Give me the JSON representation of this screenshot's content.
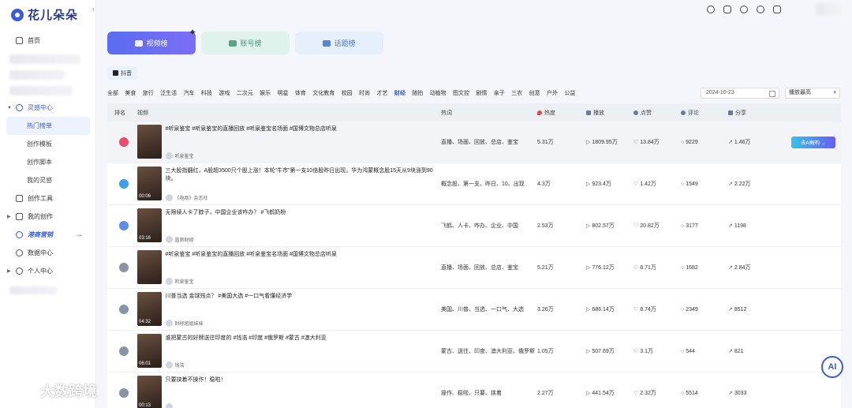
{
  "app": {
    "name": "花儿朵朵"
  },
  "sidebar": {
    "home": "首页",
    "inspiration": "灵感中心",
    "sub_items": [
      "热门榜单",
      "创作模板",
      "创作脚本",
      "我的灵感"
    ],
    "tools": "创作工具",
    "my_creation": "我的创作",
    "promo": "港商营销",
    "data_center": "数据中心",
    "personal_center": "个人中心"
  },
  "tabs": [
    {
      "label": "视频榜",
      "active": true
    },
    {
      "label": "账号榜",
      "active": false
    },
    {
      "label": "话题榜",
      "active": false
    }
  ],
  "platform": {
    "label": "抖音"
  },
  "categories": [
    "全部",
    "美食",
    "旅行",
    "泛生活",
    "汽车",
    "科技",
    "游戏",
    "二次元",
    "娱乐",
    "明星",
    "体育",
    "文化教育",
    "校园",
    "时尚",
    "才艺",
    "财经",
    "随拍",
    "动植物",
    "图文控",
    "剧情",
    "亲子",
    "三农",
    "创意",
    "户外",
    "公益"
  ],
  "active_category": "财经",
  "filters": {
    "date": "2024-10-23",
    "sort": "播放最高"
  },
  "table": {
    "headers": {
      "rank": "排名",
      "video": "视频",
      "hot": "热词",
      "heat": "热度",
      "play": "播放",
      "like": "点赞",
      "comment": "评论",
      "share": "分享"
    },
    "action_label": "去AI解构 →",
    "rows": [
      {
        "title": "#听泉鉴宝 #听泉鉴宝的直播回放 #听泉鉴宝名场面 #国博文物总店听泉",
        "author": "听泉鉴宝",
        "duration": "",
        "hot": "直播、场面、回放、总店、鉴宝",
        "heat": "5.31万",
        "play": "1809.95万",
        "like": "13.84万",
        "comment": "9229",
        "share": "1.46万",
        "medal": "#e94b6c"
      },
      {
        "title": "三大股指翻红，A股超3500只个股上涨！本轮“牛市”第一支10倍股昨日出现，华为鸿蒙概念股15天从9块涨到90块。",
        "author": "《电商》杂志社",
        "duration": "00:06",
        "hot": "概念股、第一支、昨日、10、出现",
        "heat": "4.3万",
        "play": "923.4万",
        "like": "1.42万",
        "comment": "1549",
        "share": "2.22万",
        "medal": "#3aa0e8"
      },
      {
        "title": "无限续人卡了脖子，中国企业该咋办？ #飞鹤奶粉",
        "author": "直男财经",
        "duration": "03:16",
        "hot": "飞鹤、人卡、咋办、企业、中国",
        "heat": "2.53万",
        "play": "802.57万",
        "like": "20.82万",
        "comment": "3177",
        "share": "1198",
        "medal": "#5b8de8"
      },
      {
        "title": "#听泉鉴宝 #听泉鉴宝的直播回放 #听泉鉴宝名场面 #国博文物总店听泉",
        "author": "听泉鉴宝",
        "duration": "",
        "hot": "直播、场面、回放、总店、鉴宝",
        "heat": "5.21万",
        "play": "776.12万",
        "like": "8.71万",
        "comment": "1682",
        "share": "2.84万",
        "medal": "#8a94a6"
      },
      {
        "title": "川普当选 金球残点？ #美国大选 #一口气看懂经济学",
        "author": "财经姐姐妹妹",
        "duration": "04:32",
        "hot": "美国、川普、当选、一口气、大选",
        "heat": "3.26万",
        "play": "686.14万",
        "like": "8.74万",
        "comment": "2349",
        "share": "8512",
        "medal": "#8a94a6"
      },
      {
        "title": "谁把蒙古的好牌送往印度的 #钱浩 #印度 #俄罗斯 #蒙古 #澳大利亚",
        "author": "钱浩",
        "duration": "06:01",
        "hot": "蒙古、送往、印度、澳大利亚、俄罗斯",
        "heat": "1.05万",
        "play": "507.69万",
        "like": "3.1万",
        "comment": "544",
        "share": "821",
        "medal": "#8a94a6"
      },
      {
        "title": "只要挟着不操作！稳啦！",
        "author": "",
        "duration": "00:13",
        "hot": "操作、稳啦、只要、挟着",
        "heat": "2.27万",
        "play": "441.54万",
        "like": "2.32万",
        "comment": "5514",
        "share": "3033",
        "medal": "#8a94a6"
      }
    ]
  },
  "floating": {
    "ai_label": "AI"
  },
  "watermark": {
    "text": "大数跨境"
  },
  "colors": {
    "accent": "#3b5bdb",
    "heat": "#e94b3c"
  }
}
